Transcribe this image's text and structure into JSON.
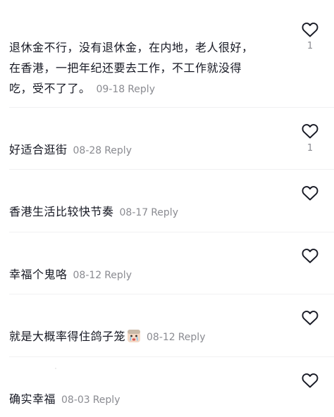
{
  "comments": [
    {
      "text_lines": [
        "退休金不行，没有退休金，在内地，老人很好，",
        "在香港，一把年纪还要去工作，不工作就没得",
        "吃，受不了了。"
      ],
      "date": "09-18",
      "reply_label": "Reply",
      "likes": "1"
    },
    {
      "text": "好适合逛街",
      "date": "08-28",
      "reply_label": "Reply",
      "likes": "1"
    },
    {
      "text": "香港生活比较快节奏",
      "date": "08-17",
      "reply_label": "Reply"
    },
    {
      "text": "幸福个鬼咯",
      "date": "08-12",
      "reply_label": "Reply"
    },
    {
      "text": "就是大概率得住鸽子笼",
      "emoji": "crying-face-emoji",
      "date": "08-12",
      "reply_label": "Reply"
    },
    {
      "text": "确实幸福",
      "date": "08-03",
      "reply_label": "Reply"
    }
  ],
  "colors": {
    "text": "#161823",
    "meta": "#8a8b91",
    "icon": "#161823",
    "divider": "#f1f1f2"
  },
  "icons": {
    "like": "heart-outline-icon"
  }
}
